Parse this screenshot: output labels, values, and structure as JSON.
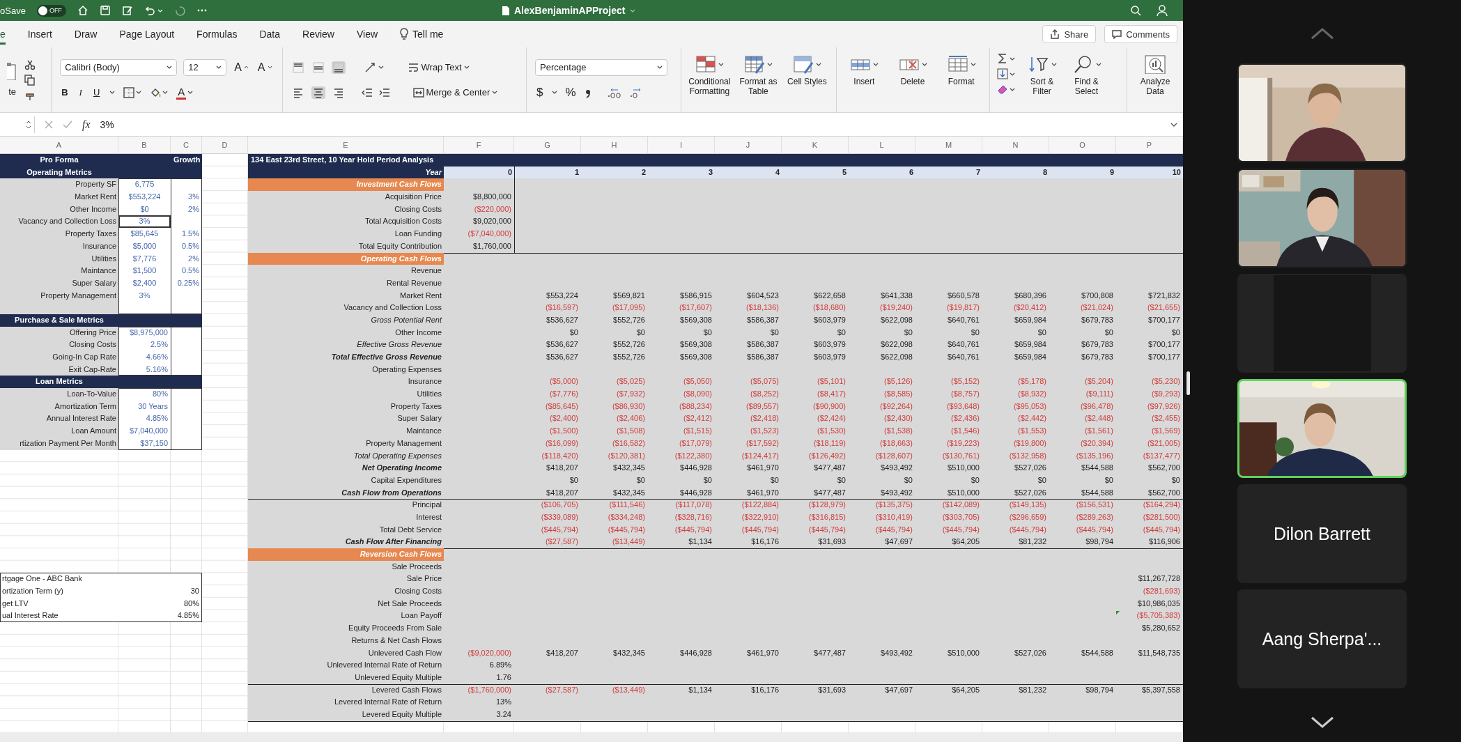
{
  "title_bar": {
    "autosave_label": "oSave",
    "autosave_on": false,
    "autosave_state": "OFF",
    "title": "AlexBenjaminAPProject"
  },
  "menu_tabs": [
    {
      "label": "e",
      "selected": true
    },
    {
      "label": "Insert",
      "selected": false
    },
    {
      "label": "Draw",
      "selected": false
    },
    {
      "label": "Page Layout",
      "selected": false
    },
    {
      "label": "Formulas",
      "selected": false
    },
    {
      "label": "Data",
      "selected": false
    },
    {
      "label": "Review",
      "selected": false
    },
    {
      "label": "View",
      "selected": false
    }
  ],
  "tell_me": "Tell me",
  "share": "Share",
  "comments": "Comments",
  "ribbon": {
    "paste_label": "te",
    "font": "Calibri (Body)",
    "font_size": "12",
    "grow_font": "A",
    "shrink_font": "A",
    "bold": "B",
    "italic": "I",
    "underline": "U",
    "font_color": "A",
    "vertical_align_buttons": [
      {
        "selected": false
      },
      {
        "selected": false
      },
      {
        "selected": true
      }
    ],
    "horizontal_align_buttons": [
      {
        "selected": false
      },
      {
        "selected": true
      },
      {
        "selected": false
      }
    ],
    "wrap_text": "Wrap Text",
    "merge_center": "Merge & Center",
    "number_format": "Percentage",
    "currency": "$",
    "percent": "%",
    "style_buttons": [
      {
        "label": "Conditional Formatting",
        "kind": "conditional_formatting"
      },
      {
        "label": "Format as Table",
        "kind": "format_table"
      },
      {
        "label": "Cell Styles",
        "kind": "cell_styles"
      }
    ],
    "cell_buttons": [
      {
        "label": "Insert",
        "kind": "insert"
      },
      {
        "label": "Delete",
        "kind": "delete"
      },
      {
        "label": "Format",
        "kind": "format"
      }
    ],
    "editing_buttons": [
      {
        "label": "Sort & Filter",
        "kind": "sort_filter"
      },
      {
        "label": "Find & Select",
        "kind": "find_select"
      }
    ],
    "analyze": {
      "label": "Analyze Data",
      "kind": "analyze"
    }
  },
  "formula_bar": {
    "fx": "fx",
    "value": "3%"
  },
  "sheet": {
    "columns": [
      "A",
      "B",
      "C",
      "D",
      "E",
      "F",
      "G",
      "H",
      "I",
      "J",
      "K",
      "L",
      "M",
      "N",
      "O",
      "P"
    ],
    "left_rows": [
      {
        "kind": "header",
        "label": "Pro Forma",
        "growth": "Growth"
      },
      {
        "kind": "header",
        "label": "Operating Metrics"
      },
      {
        "kind": "field",
        "label": "Property SF",
        "value": "6,775",
        "selected": false
      },
      {
        "kind": "field",
        "label": "Market Rent",
        "value": "$553,224",
        "growth": "3%",
        "selected": false
      },
      {
        "kind": "field",
        "label": "Other Income",
        "value": "$0",
        "growth": "2%",
        "selected": false
      },
      {
        "kind": "field",
        "label": "Vacancy and Collection Loss",
        "value": "3%",
        "selected": true
      },
      {
        "kind": "field",
        "label": "Property Taxes",
        "value": "$85,645",
        "growth": "1.5%",
        "selected": false
      },
      {
        "kind": "field",
        "label": "Insurance",
        "value": "$5,000",
        "growth": "0.5%",
        "selected": false
      },
      {
        "kind": "field",
        "label": "Utilities",
        "value": "$7,776",
        "growth": "2%",
        "selected": false
      },
      {
        "kind": "field",
        "label": "Maintance",
        "value": "$1,500",
        "growth": "0.5%",
        "selected": false
      },
      {
        "kind": "field",
        "label": "Super Salary",
        "value": "$2,400",
        "growth": "0.25%",
        "selected": false
      },
      {
        "kind": "field",
        "label": "Property Management",
        "value": "3%",
        "selected": false
      },
      {
        "kind": "blank"
      },
      {
        "kind": "header",
        "label": "Purchase & Sale Metrics"
      },
      {
        "kind": "field",
        "label": "Offering Price",
        "value": "$8,975,000",
        "selected": false
      },
      {
        "kind": "field",
        "label": "Closing Costs",
        "value": "2.5%",
        "selected": false
      },
      {
        "kind": "field",
        "label": "Going-In Cap Rate",
        "value": "4.66%",
        "selected": false
      },
      {
        "kind": "field",
        "label": "Exit Cap-Rate",
        "value": "5.16%",
        "selected": false
      },
      {
        "kind": "header",
        "label": "Loan Metrics"
      },
      {
        "kind": "field",
        "label": "Loan-To-Value",
        "value": "80%",
        "selected": false
      },
      {
        "kind": "field",
        "label": "Amortization Term",
        "value": "30 Years",
        "selected": false
      },
      {
        "kind": "field",
        "label": "Annual Interest Rate",
        "value": "4.85%",
        "selected": false
      },
      {
        "kind": "field",
        "label": "Loan Amount",
        "value": "$7,040,000",
        "selected": false
      },
      {
        "kind": "field",
        "label": "rtization Payment Per Month",
        "value": "$37,150",
        "selected": false
      }
    ],
    "loan_box": [
      {
        "label": "rtgage One - ABC Bank"
      },
      {
        "label": "ortization Term (y)",
        "value": "30"
      },
      {
        "label": "get LTV",
        "value": "80%"
      },
      {
        "label": "ual Interest Rate",
        "value": "4.85%"
      }
    ],
    "title": "134 East 23rd Street, 10 Year Hold Period Analysis",
    "year_row": {
      "label": "Year",
      "f": "0",
      "years": [
        "1",
        "2",
        "3",
        "4",
        "5",
        "6",
        "7",
        "8",
        "9",
        "10"
      ]
    },
    "blocks": [
      [
        {
          "kind": "section",
          "label": "Investment Cash Flows"
        },
        {
          "kind": "line",
          "label": "Acquisition Price",
          "italic": false,
          "bold": false,
          "f": {
            "text": "$8,800,000",
            "negative": false
          }
        },
        {
          "kind": "line",
          "label": "Closing Costs",
          "italic": false,
          "bold": false,
          "f": {
            "text": "($220,000)",
            "negative": true
          }
        },
        {
          "kind": "line",
          "label": "Total Acquisition Costs",
          "italic": false,
          "bold": false,
          "f": {
            "text": "$9,020,000",
            "negative": false
          }
        },
        {
          "kind": "line",
          "label": "Loan Funding",
          "italic": false,
          "bold": false,
          "f": {
            "text": "($7,040,000)",
            "negative": true
          }
        },
        {
          "kind": "line",
          "label": "Total Equity Contribution",
          "italic": false,
          "bold": false,
          "f": {
            "text": "$1,760,000",
            "negative": false
          }
        }
      ],
      [
        {
          "kind": "section",
          "label": "Operating Cash Flows"
        },
        {
          "kind": "line",
          "label": "Revenue",
          "italic": false,
          "bold": false
        },
        {
          "kind": "line",
          "label": "Rental Revenue",
          "italic": false,
          "bold": false
        },
        {
          "kind": "line",
          "label": "Market Rent",
          "italic": false,
          "bold": false,
          "negative": false,
          "years": [
            "$553,224",
            "$569,821",
            "$586,915",
            "$604,523",
            "$622,658",
            "$641,338",
            "$660,578",
            "$680,396",
            "$700,808",
            "$721,832"
          ]
        },
        {
          "kind": "line",
          "label": "Vacancy and Collection Loss",
          "italic": false,
          "bold": false,
          "negative": true,
          "years": [
            "($16,597)",
            "($17,095)",
            "($17,607)",
            "($18,136)",
            "($18,680)",
            "($19,240)",
            "($19,817)",
            "($20,412)",
            "($21,024)",
            "($21,655)"
          ]
        },
        {
          "kind": "line",
          "label": "Gross Potential Rent",
          "italic": true,
          "bold": false,
          "negative": false,
          "years": [
            "$536,627",
            "$552,726",
            "$569,308",
            "$586,387",
            "$603,979",
            "$622,098",
            "$640,761",
            "$659,984",
            "$679,783",
            "$700,177"
          ]
        },
        {
          "kind": "line",
          "label": "Other Income",
          "italic": false,
          "bold": false,
          "negative": false,
          "years": [
            "$0",
            "$0",
            "$0",
            "$0",
            "$0",
            "$0",
            "$0",
            "$0",
            "$0",
            "$0"
          ]
        },
        {
          "kind": "line",
          "label": "Effective Gross Revenue",
          "italic": true,
          "bold": false,
          "negative": false,
          "years": [
            "$536,627",
            "$552,726",
            "$569,308",
            "$586,387",
            "$603,979",
            "$622,098",
            "$640,761",
            "$659,984",
            "$679,783",
            "$700,177"
          ]
        },
        {
          "kind": "line",
          "label": "Total Effective Gross Revenue",
          "italic": true,
          "bold": true,
          "negative": false,
          "years": [
            "$536,627",
            "$552,726",
            "$569,308",
            "$586,387",
            "$603,979",
            "$622,098",
            "$640,761",
            "$659,984",
            "$679,783",
            "$700,177"
          ]
        },
        {
          "kind": "line",
          "label": "Operating Expenses",
          "italic": false,
          "bold": false
        },
        {
          "kind": "line",
          "label": "Insurance",
          "italic": false,
          "bold": false,
          "negative": true,
          "years": [
            "($5,000)",
            "($5,025)",
            "($5,050)",
            "($5,075)",
            "($5,101)",
            "($5,126)",
            "($5,152)",
            "($5,178)",
            "($5,204)",
            "($5,230)"
          ]
        },
        {
          "kind": "line",
          "label": "Utilities",
          "italic": false,
          "bold": false,
          "negative": true,
          "years": [
            "($7,776)",
            "($7,932)",
            "($8,090)",
            "($8,252)",
            "($8,417)",
            "($8,585)",
            "($8,757)",
            "($8,932)",
            "($9,111)",
            "($9,293)"
          ]
        },
        {
          "kind": "line",
          "label": "Property Taxes",
          "italic": false,
          "bold": false,
          "negative": true,
          "years": [
            "($85,645)",
            "($86,930)",
            "($88,234)",
            "($89,557)",
            "($90,900)",
            "($92,264)",
            "($93,648)",
            "($95,053)",
            "($96,478)",
            "($97,926)"
          ]
        },
        {
          "kind": "line",
          "label": "Super Salary",
          "italic": false,
          "bold": false,
          "negative": true,
          "years": [
            "($2,400)",
            "($2,406)",
            "($2,412)",
            "($2,418)",
            "($2,424)",
            "($2,430)",
            "($2,436)",
            "($2,442)",
            "($2,448)",
            "($2,455)"
          ]
        },
        {
          "kind": "line",
          "label": "Maintance",
          "italic": false,
          "bold": false,
          "negative": true,
          "years": [
            "($1,500)",
            "($1,508)",
            "($1,515)",
            "($1,523)",
            "($1,530)",
            "($1,538)",
            "($1,546)",
            "($1,553)",
            "($1,561)",
            "($1,569)"
          ]
        },
        {
          "kind": "line",
          "label": "Property Management",
          "italic": false,
          "bold": false,
          "negative": true,
          "years": [
            "($16,099)",
            "($16,582)",
            "($17,079)",
            "($17,592)",
            "($18,119)",
            "($18,663)",
            "($19,223)",
            "($19,800)",
            "($20,394)",
            "($21,005)"
          ]
        },
        {
          "kind": "line",
          "label": "Total Operating Expenses",
          "italic": true,
          "bold": false,
          "negative": true,
          "years": [
            "($118,420)",
            "($120,381)",
            "($122,380)",
            "($124,417)",
            "($126,492)",
            "($128,607)",
            "($130,761)",
            "($132,958)",
            "($135,196)",
            "($137,477)"
          ]
        },
        {
          "kind": "line",
          "label": "Net Operating Income",
          "italic": true,
          "bold": true,
          "negative": false,
          "years": [
            "$418,207",
            "$432,345",
            "$446,928",
            "$461,970",
            "$477,487",
            "$493,492",
            "$510,000",
            "$527,026",
            "$544,588",
            "$562,700"
          ]
        },
        {
          "kind": "line",
          "label": "Capital Expenditures",
          "italic": false,
          "bold": false,
          "negative": false,
          "years": [
            "$0",
            "$0",
            "$0",
            "$0",
            "$0",
            "$0",
            "$0",
            "$0",
            "$0",
            "$0"
          ]
        },
        {
          "kind": "line",
          "label": "Cash Flow from Operations",
          "italic": true,
          "bold": true,
          "negative": false,
          "years": [
            "$418,207",
            "$432,345",
            "$446,928",
            "$461,970",
            "$477,487",
            "$493,492",
            "$510,000",
            "$527,026",
            "$544,588",
            "$562,700"
          ]
        }
      ],
      [
        {
          "kind": "line",
          "label": "Principal",
          "italic": false,
          "bold": false,
          "negative": true,
          "years": [
            "($106,705)",
            "($111,546)",
            "($117,078)",
            "($122,884)",
            "($128,979)",
            "($135,375)",
            "($142,089)",
            "($149,135)",
            "($156,531)",
            "($164,294)"
          ]
        },
        {
          "kind": "line",
          "label": "Interest",
          "italic": false,
          "bold": false,
          "negative": true,
          "years": [
            "($339,089)",
            "($334,248)",
            "($328,716)",
            "($322,910)",
            "($316,815)",
            "($310,419)",
            "($303,705)",
            "($296,659)",
            "($289,263)",
            "($281,500)"
          ]
        },
        {
          "kind": "line",
          "label": "Total Debt Service",
          "italic": false,
          "bold": false,
          "negative": true,
          "years": [
            "($445,794)",
            "($445,794)",
            "($445,794)",
            "($445,794)",
            "($445,794)",
            "($445,794)",
            "($445,794)",
            "($445,794)",
            "($445,794)",
            "($445,794)"
          ]
        },
        {
          "kind": "line",
          "label": "Cash Flow After Financing",
          "italic": true,
          "bold": true,
          "years": [
            {
              "text": "($27,587)",
              "negative": true
            },
            {
              "text": "($13,449)",
              "negative": true
            },
            {
              "text": "$1,134",
              "negative": false
            },
            {
              "text": "$16,176",
              "negative": false
            },
            {
              "text": "$31,693",
              "negative": false
            },
            {
              "text": "$47,697",
              "negative": false
            },
            {
              "text": "$64,205",
              "negative": false
            },
            {
              "text": "$81,232",
              "negative": false
            },
            {
              "text": "$98,794",
              "negative": false
            },
            {
              "text": "$116,906",
              "negative": false
            }
          ]
        }
      ],
      [
        {
          "kind": "section",
          "label": "Reversion Cash Flows"
        },
        {
          "kind": "line",
          "label": "Sale Proceeds",
          "italic": false,
          "bold": false
        },
        {
          "kind": "line",
          "label": "Sale Price",
          "italic": false,
          "bold": false,
          "p": {
            "text": "$11,267,728",
            "negative": false,
            "flagged": false
          }
        },
        {
          "kind": "line",
          "label": "Closing Costs",
          "italic": false,
          "bold": false,
          "p": {
            "text": "($281,693)",
            "negative": true,
            "flagged": false
          }
        },
        {
          "kind": "line",
          "label": "Net Sale Proceeds",
          "italic": false,
          "bold": false,
          "p": {
            "text": "$10,986,035",
            "negative": false,
            "flagged": false
          }
        },
        {
          "kind": "line",
          "label": "Loan Payoff",
          "italic": false,
          "bold": false,
          "p": {
            "text": "($5,705,383)",
            "negative": true,
            "flagged": true
          }
        },
        {
          "kind": "line",
          "label": "Equity Proceeds From Sale",
          "italic": false,
          "bold": false,
          "p": {
            "text": "$5,280,652",
            "negative": false,
            "flagged": false
          }
        },
        {
          "kind": "line",
          "label": "Returns & Net Cash Flows",
          "italic": false,
          "bold": false
        },
        {
          "kind": "line",
          "label": "Unlevered Cash Flow",
          "italic": false,
          "bold": false,
          "f": {
            "text": "($9,020,000)",
            "negative": true
          },
          "negative": false,
          "years": [
            "$418,207",
            "$432,345",
            "$446,928",
            "$461,970",
            "$477,487",
            "$493,492",
            "$510,000",
            "$527,026",
            "$544,588",
            "$11,548,735"
          ]
        },
        {
          "kind": "line",
          "label": "Unlevered Internal Rate of Return",
          "italic": false,
          "bold": false,
          "f": {
            "text": "6.89%",
            "negative": false
          }
        },
        {
          "kind": "line",
          "label": "Unlevered Equity Multiple",
          "italic": false,
          "bold": false,
          "f": {
            "text": "1.76",
            "negative": false
          }
        }
      ],
      [
        {
          "kind": "line",
          "label": "Levered Cash Flows",
          "italic": false,
          "bold": false,
          "f": {
            "text": "($1,760,000)",
            "negative": true
          },
          "years": [
            {
              "text": "($27,587)",
              "negative": true
            },
            {
              "text": "($13,449)",
              "negative": true
            },
            {
              "text": "$1,134",
              "negative": false
            },
            {
              "text": "$16,176",
              "negative": false
            },
            {
              "text": "$31,693",
              "negative": false
            },
            {
              "text": "$47,697",
              "negative": false
            },
            {
              "text": "$64,205",
              "negative": false
            },
            {
              "text": "$81,232",
              "negative": false
            },
            {
              "text": "$98,794",
              "negative": false
            },
            {
              "text": "$5,397,558",
              "negative": false
            }
          ]
        },
        {
          "kind": "line",
          "label": "Levered Internal Rate of Return",
          "italic": false,
          "bold": false,
          "f": {
            "text": "13%",
            "negative": false
          }
        },
        {
          "kind": "line",
          "label": "Levered Equity Multiple",
          "italic": false,
          "bold": false,
          "f": {
            "text": "3.24",
            "negative": false
          }
        }
      ]
    ]
  },
  "participants": [
    {
      "kind": "video",
      "speaking": false
    },
    {
      "kind": "video",
      "speaking": false
    },
    {
      "kind": "blank",
      "speaking": false
    },
    {
      "kind": "video",
      "speaking": true
    },
    {
      "kind": "name",
      "name": "Dilon Barrett",
      "speaking": false
    },
    {
      "kind": "name",
      "name": "Aang Sherpa'...",
      "speaking": false
    }
  ]
}
